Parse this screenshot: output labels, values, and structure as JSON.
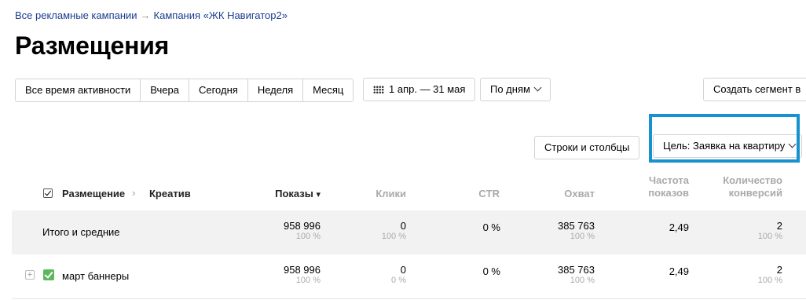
{
  "breadcrumb": {
    "root": "Все рекламные кампании",
    "arrow": "→",
    "campaign": "Кампания «ЖК Навигатор2»"
  },
  "page_title": "Размещения",
  "periods": [
    "Все время активности",
    "Вчера",
    "Сегодня",
    "Неделя",
    "Месяц"
  ],
  "date_range": "1 апр. — 31 мая",
  "grouping": "По дням",
  "create_segment": "Создать сегмент в",
  "rows_columns": "Строки и столбцы",
  "goal_select": "Цель: Заявка на квартиру",
  "columns": {
    "placement": "Размещение",
    "sep": "›",
    "creative": "Креатив",
    "shows": "Показы",
    "sort_icon": "▾",
    "clicks": "Клики",
    "ctr": "CTR",
    "reach": "Охват",
    "freq_1": "Частота",
    "freq_2": "показов",
    "conv_1": "Количество",
    "conv_2": "конверсий"
  },
  "rows": [
    {
      "label": "Итого и средние",
      "shows": "958 996",
      "shows_pct": "100 %",
      "clicks": "0",
      "clicks_pct": "100 %",
      "ctr": "0 %",
      "reach": "385 763",
      "reach_pct": "100 %",
      "freq": "2,49",
      "conv": "2",
      "conv_pct": "100 %"
    },
    {
      "label": "март баннеры",
      "expand": "+",
      "shows": "958 996",
      "shows_pct": "100 %",
      "clicks": "0",
      "clicks_pct": "0 %",
      "ctr": "0 %",
      "reach": "385 763",
      "reach_pct": "100 %",
      "freq": "2,49",
      "conv": "2",
      "conv_pct": "100 %"
    }
  ],
  "accent_color": "#1592cf",
  "check_color": "#5cb85c"
}
